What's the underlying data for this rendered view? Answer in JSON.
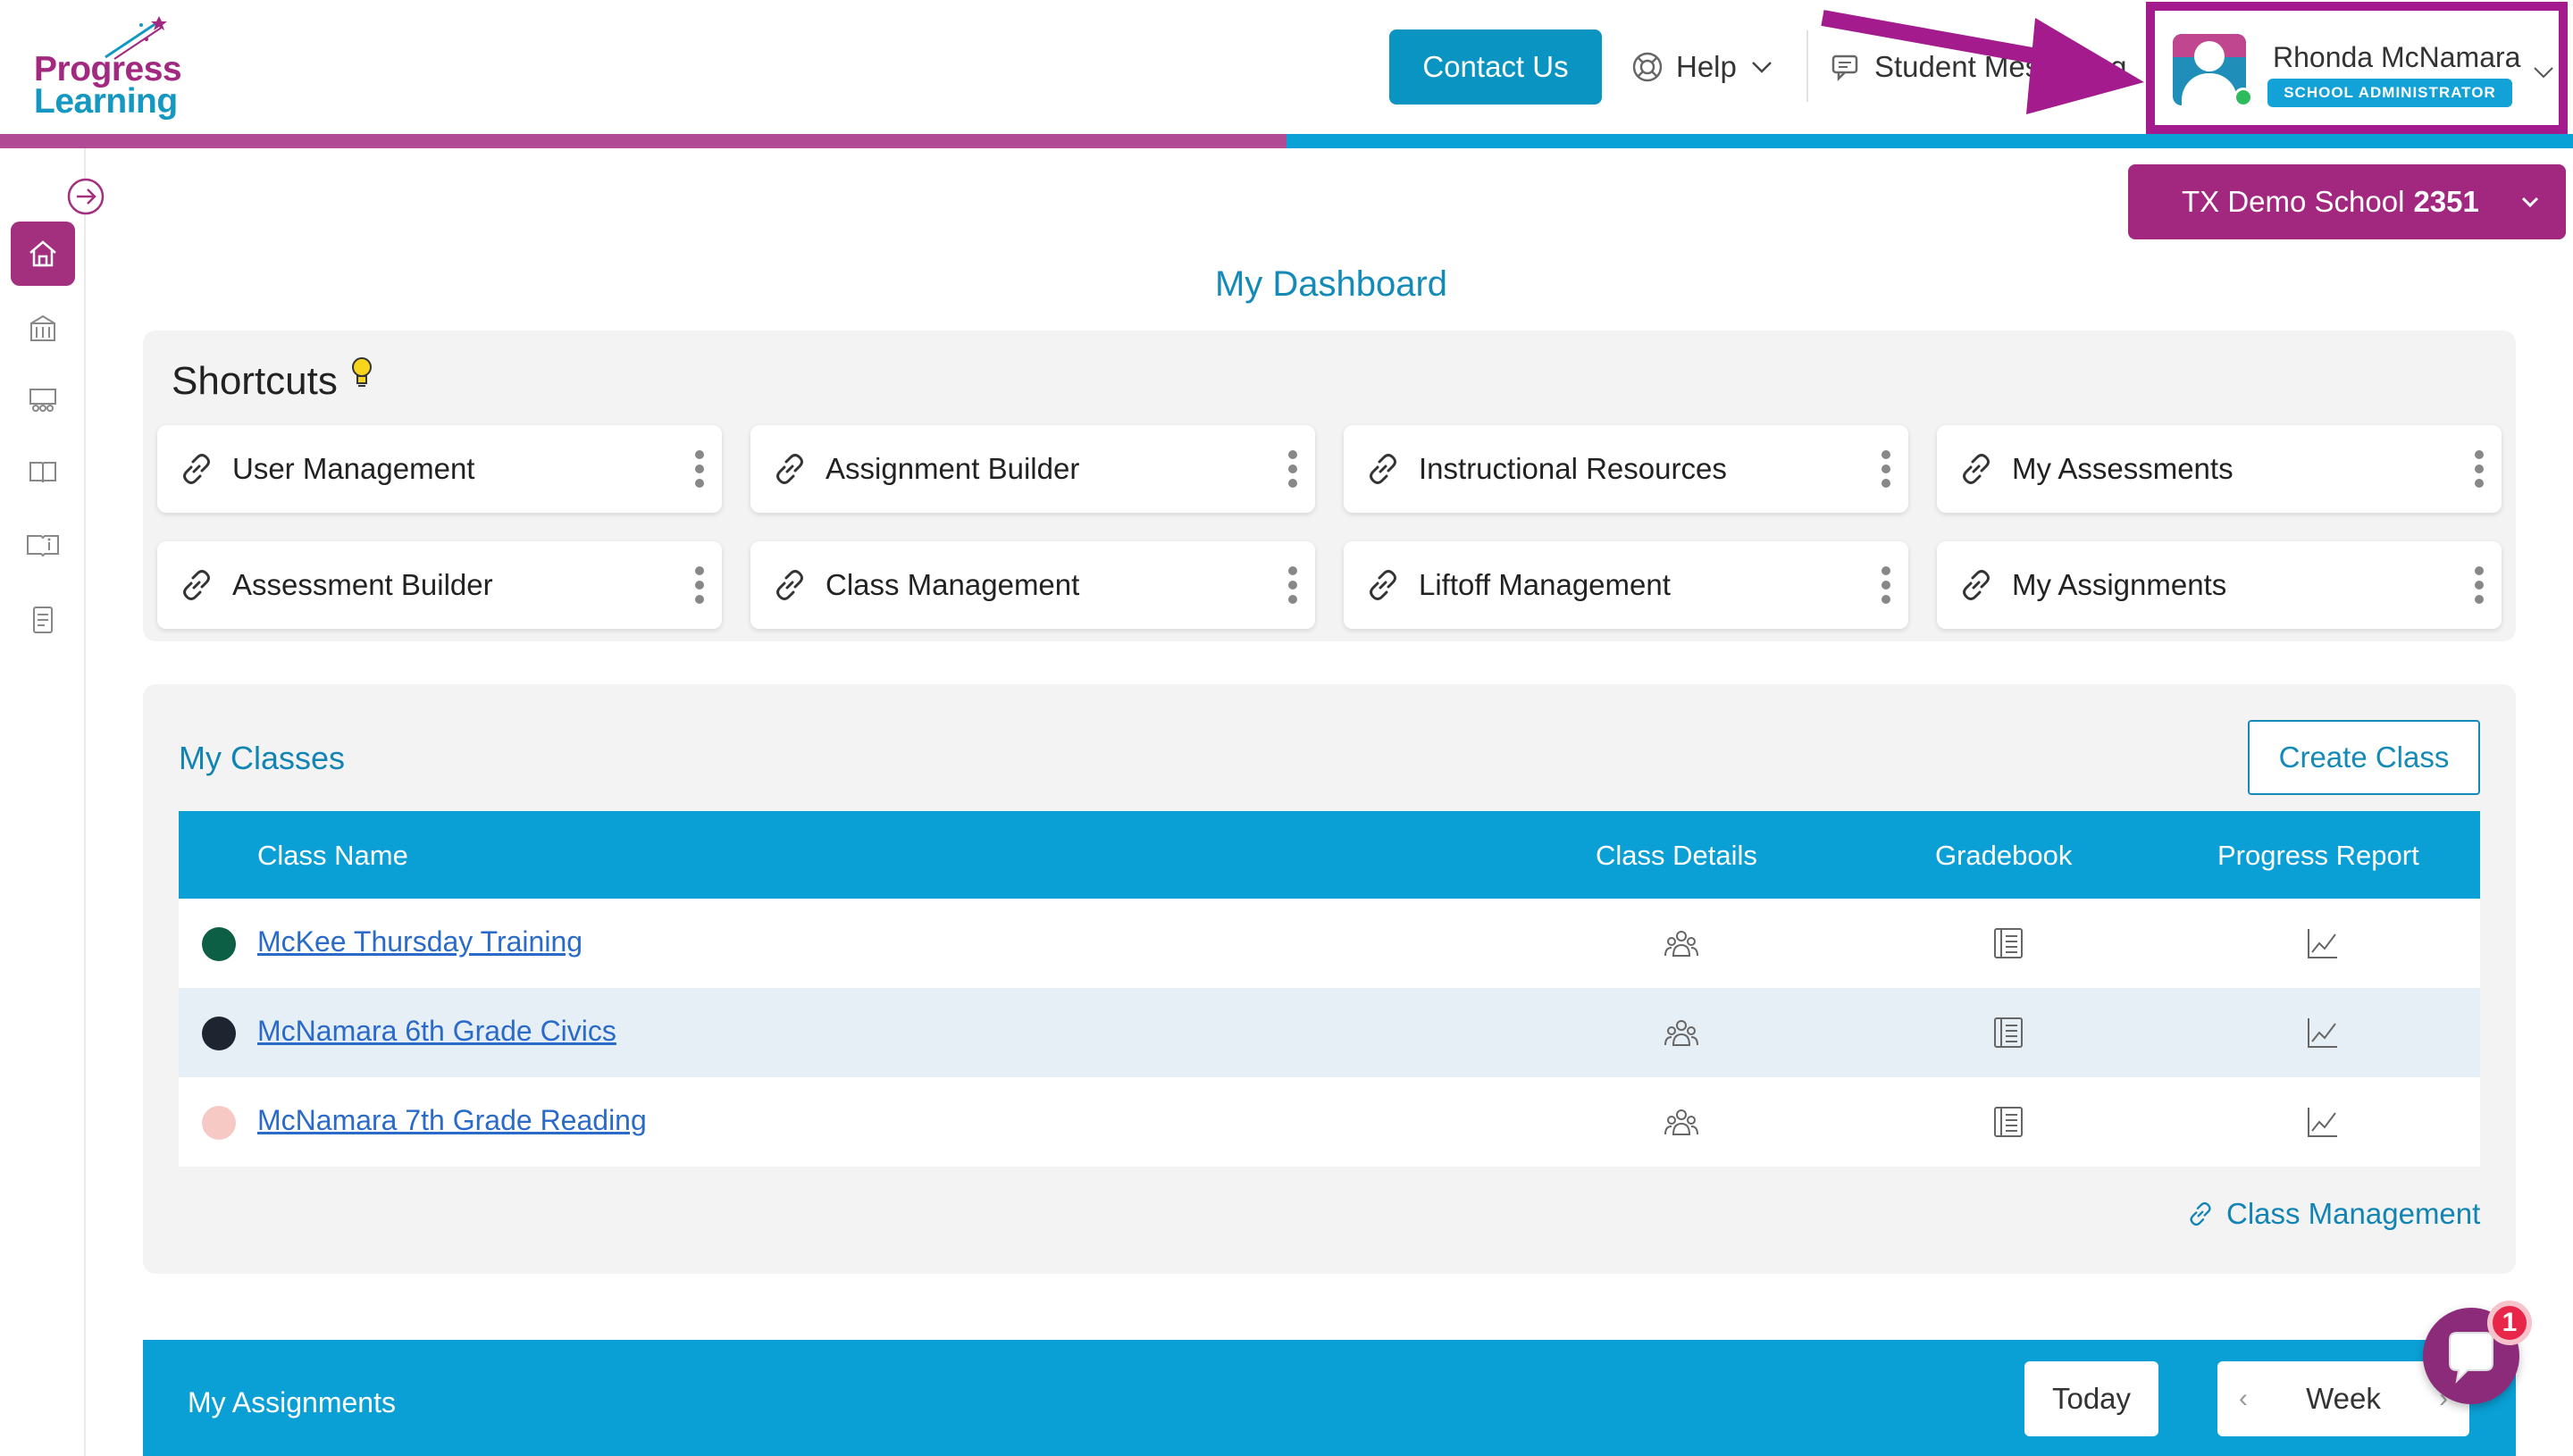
{
  "brand": {
    "line1": "Progress",
    "line2": "Learning"
  },
  "header": {
    "contact_label": "Contact Us",
    "help_label": "Help",
    "student_messaging_label": "Student Messaging",
    "user_name": "Rhonda McNamara",
    "user_role": "SCHOOL ADMINISTRATOR"
  },
  "school": {
    "prefix": "TX Demo School",
    "number": "2351"
  },
  "page_title": "My Dashboard",
  "shortcuts": {
    "title": "Shortcuts",
    "items": [
      {
        "label": "User Management"
      },
      {
        "label": "Assignment Builder"
      },
      {
        "label": "Instructional Resources"
      },
      {
        "label": "My Assessments"
      },
      {
        "label": "Assessment Builder"
      },
      {
        "label": "Class Management"
      },
      {
        "label": "Liftoff Management"
      },
      {
        "label": "My Assignments"
      }
    ]
  },
  "classes": {
    "title": "My Classes",
    "create_label": "Create Class",
    "columns": {
      "name": "Class Name",
      "details": "Class Details",
      "gradebook": "Gradebook",
      "progress": "Progress Report"
    },
    "rows": [
      {
        "name": "McKee Thursday Training",
        "color": "#0c5e45"
      },
      {
        "name": "McNamara 6th Grade Civics",
        "color": "#1f2530"
      },
      {
        "name": "McNamara 7th Grade Reading",
        "color": "#f6c9c5"
      }
    ],
    "footer_link": "Class Management"
  },
  "assignments": {
    "title": "My Assignments",
    "today_label": "Today",
    "view_label": "Week",
    "prev_arrow": "‹",
    "next_arrow": "›"
  },
  "chat": {
    "badge": "1"
  },
  "colors": {
    "brand_purple": "#a1277f",
    "brand_blue": "#0aa0d6",
    "annotation": "#a31b8c"
  }
}
